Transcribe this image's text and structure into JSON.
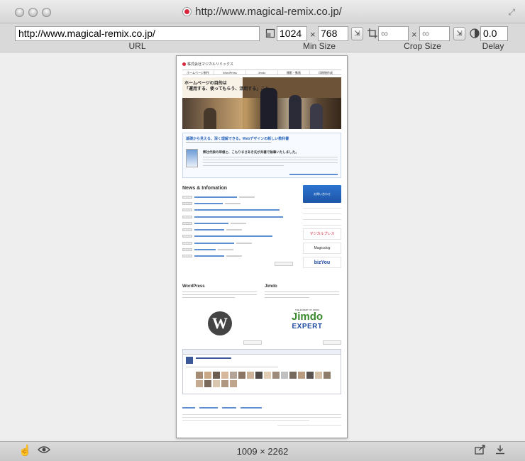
{
  "window": {
    "title": "http://www.magical-remix.co.jp/"
  },
  "toolbar": {
    "url_value": "http://www.magical-remix.co.jp/",
    "url_label": "URL",
    "min_width": "1024",
    "min_height": "768",
    "min_size_label": "Min Size",
    "crop_width": "∞",
    "crop_height": "∞",
    "crop_size_label": "Crop Size",
    "delay": "0.0",
    "delay_label": "Delay",
    "times": "×"
  },
  "status": {
    "dimensions": "1009 × 2262"
  },
  "preview": {
    "company": "株式会社マジカルリミックス",
    "nav": [
      "ホームページ制作",
      "WordPress",
      "Jimdo",
      "撮影・動画",
      "印刷物作成"
    ],
    "hero_text": "ホームページの目的は\n「運用する、使ってもらう、活用する」こと",
    "book_title": "基礎から見える、深く理解できる。Webデザインの新しい教科書",
    "book_sub": "弊社代表の岸根と、こもりまさあき氏が共著で執筆いたしました。",
    "news_title": "News & Infomation",
    "contact": "お問い合わせ",
    "banners": [
      "マジカルプレス",
      "Magicalog",
      "bizYou"
    ],
    "wordpress_heading": "WordPress",
    "jimdo_heading": "Jimdo",
    "jimdo_small": "THE EXPERT OF JIMDO",
    "jimdo_word": "Jimdo",
    "jimdo_expert": "EXPERT",
    "wp_glyph": "W"
  },
  "colors": {
    "accent_blue": "#2d74d1",
    "brand_red": "#d8273b"
  }
}
